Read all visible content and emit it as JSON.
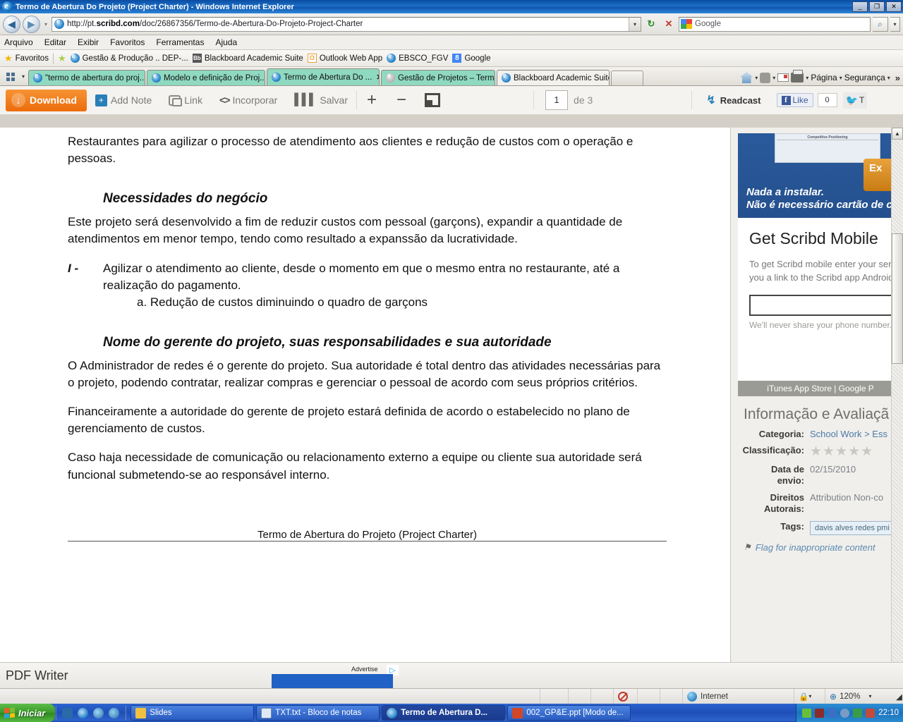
{
  "window": {
    "title": "Termo de Abertura Do Projeto (Project Charter) - Windows Internet Explorer",
    "minimize": "_",
    "maximize": "❐",
    "close": "✕"
  },
  "address": {
    "back_icon": "◀",
    "forward_icon": "▶",
    "url_prefix": "http://pt.",
    "url_bold": "scribd.com",
    "url_suffix": "/doc/26867356/Termo-de-Abertura-Do-Projeto-Project-Charter",
    "refresh_icon": "↻",
    "stop_icon": "✕",
    "search_value": "Google",
    "search_go_icon": "🔍"
  },
  "menu": [
    "Arquivo",
    "Editar",
    "Exibir",
    "Favoritos",
    "Ferramentas",
    "Ajuda"
  ],
  "favorites_bar": {
    "label": "Favoritos",
    "items": [
      "Gestão & Produção .. DEP-...",
      "Blackboard Academic Suite",
      "Outlook Web App",
      "EBSCO_FGV",
      "Google"
    ]
  },
  "tabs": [
    {
      "label": "\"termo de abertura do proj...",
      "active": false
    },
    {
      "label": "Modelo e definição de Proj...",
      "active": false
    },
    {
      "label": "Termo de Abertura Do ...",
      "active": true
    },
    {
      "label": "Gestão de Projetos – Term...",
      "active": false
    },
    {
      "label": "Blackboard Academic Suite",
      "active": false
    }
  ],
  "tab_right": {
    "page_label": "Página",
    "security_label": "Segurança",
    "overflow": "»"
  },
  "scribd_toolbar": {
    "download": "Download",
    "add_note": "Add Note",
    "link": "Link",
    "embed": "Incorporar",
    "save": "Salvar",
    "zoom_in": "+",
    "zoom_out": "−",
    "page_value": "1",
    "page_of": "de 3",
    "readcast": "Readcast",
    "like": "Like",
    "like_count": "0",
    "tweet": "T"
  },
  "document": {
    "para_top": "Restaurantes para agilizar o processo de atendimento aos clientes e redução de custos com o operação e pessoas.",
    "heading_1": "Necessidades do negócio",
    "para_1": "Este projeto será desenvolvido a fim de reduzir custos com pessoal (garçons), expandir a quantidade de atendimentos em menor tempo, tendo como resultado a expanssão da lucratividade.",
    "bullet_mark": "I -",
    "bullet_1": "Agilizar o atendimento ao cliente, desde o momento em que o mesmo entra no restaurante, até a realização do pagamento.",
    "sub_item_1": "a.  Redução de custos diminuindo o quadro de garçons",
    "heading_2": "Nome do gerente do projeto, suas responsabilidades e sua autoridade",
    "para_2": "O Administrador de redes é o gerente do projeto. Sua autoridade é total dentro das atividades necessárias para o projeto, podendo contratar, realizar compras e gerenciar o pessoal de acordo com seus próprios critérios.",
    "para_3": "Financeiramente a autoridade do gerente de projeto estará definida de acordo o estabelecido no plano de gerenciamento de custos.",
    "para_4": "Caso haja necessidade de comunicação ou relacionamento externo a equipe ou cliente sua autoridade será funcional submetendo-se ao responsável interno.",
    "footer": "Termo de Abertura do Projeto (Project Charter)"
  },
  "sidebar": {
    "ad": {
      "mini_header": "Competitive Positioning",
      "line_1": "Nada a instalar.",
      "line_2": "Não é necessário cartão de cr",
      "cta": "Ex"
    },
    "mobile": {
      "title": "Get Scribd Mobile",
      "body": "To get Scribd mobile enter your send you a link to the Scribd app Android.",
      "never_share": "We'll never share your phone number.",
      "store_bar": "iTunes App Store | Google P"
    },
    "info": {
      "title": "Informação e Avaliaçã",
      "rows": [
        {
          "label": "Categoria:",
          "value": "School Work > Ess"
        },
        {
          "label": "Classificação:",
          "value": "★★★★★"
        },
        {
          "label": "Data de envio:",
          "value": "02/15/2010"
        },
        {
          "label": "Direitos Autorais:",
          "value": "Attribution Non-co"
        },
        {
          "label": "Tags:",
          "value": "davis alves redes pmi"
        }
      ],
      "flag": "Flag for inappropriate content"
    }
  },
  "pdf_writer": {
    "label": "PDF Writer",
    "advertise": "Advertise"
  },
  "status_bar": {
    "zone": "Internet",
    "zoom": "120%"
  },
  "taskbar": {
    "start": "Iniciar",
    "tasks": [
      {
        "label": "Slides",
        "active": false
      },
      {
        "label": "TXT.txt - Bloco de notas",
        "active": false
      },
      {
        "label": "Termo de Abertura D...",
        "active": true
      },
      {
        "label": "002_GP&E.ppt [Modo de...",
        "active": false
      }
    ],
    "clock": "22:10"
  }
}
